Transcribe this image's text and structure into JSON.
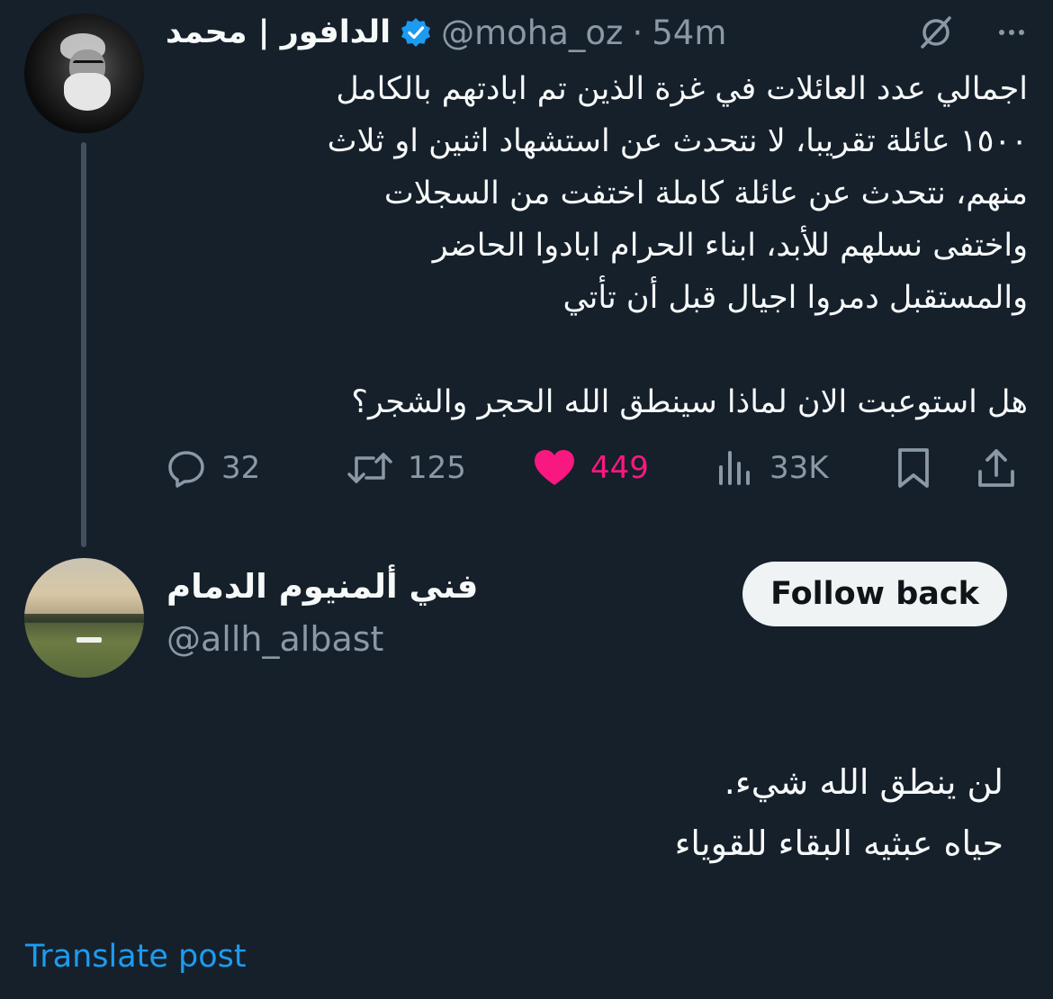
{
  "tweet": {
    "author_name": "الدافور | محمد",
    "handle": "@moha_oz",
    "separator": "·",
    "time": "54m",
    "lines": [
      "اجمالي عدد العائلات في غزة الذين تم ابادتهم بالكامل",
      "١٥٠٠ عائلة تقريبا، لا نتحدث عن استشهاد اثنين او ثلاث",
      "منهم، نتحدث عن عائلة كاملة اختفت من السجلات",
      "واختفى نسلهم للأبد، ابناء الحرام ابادوا الحاضر",
      "والمستقبل دمروا اجيال قبل أن تأتي"
    ],
    "last_line": "هل استوعبت الان لماذا سينطق الله الحجر والشجر؟",
    "actions": {
      "replies": "32",
      "reposts": "125",
      "likes": "449",
      "views": "33K"
    },
    "colors": {
      "like": "#f91880",
      "verified": "#1d9bf0"
    }
  },
  "reply": {
    "author_name": "فني ألمنيوم الدمام",
    "handle": "@allh_albast",
    "follow_label": "Follow back",
    "lines": [
      "لن ينطق الله شيء.",
      "حياه عبثيه البقاء للقوياء"
    ],
    "translate_label": "Translate post"
  },
  "icons": {
    "more": "more-icon",
    "grok": "grok-icon",
    "verified": "verified-badge-icon",
    "reply": "reply-icon",
    "repost": "repost-icon",
    "like": "heart-icon",
    "views": "views-icon",
    "bookmark": "bookmark-icon",
    "share": "share-icon"
  }
}
